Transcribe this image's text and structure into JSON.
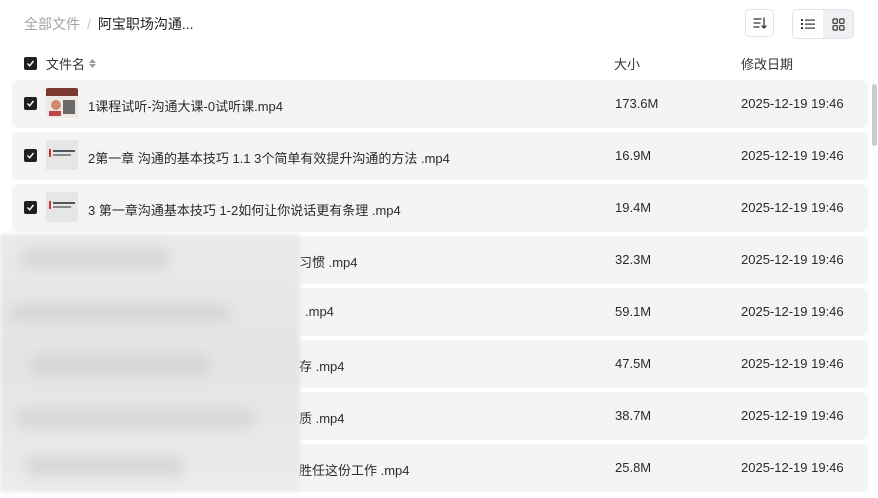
{
  "breadcrumb": {
    "root": "全部文件",
    "separator": "/",
    "current": "阿宝职场沟通..."
  },
  "toolbar": {
    "sort_icon": "sort-icon",
    "list_icon": "list-view-icon",
    "grid_icon": "grid-view-icon"
  },
  "header": {
    "name": "文件名",
    "size": "大小",
    "date": "修改日期"
  },
  "files": [
    {
      "name": "1课程试听-沟通大课-0试听课.mp4",
      "size": "173.6M",
      "date": "2025-12-19 19:46"
    },
    {
      "name": "2第一章 沟通的基本技巧 1.1 3个简单有效提升沟通的方法 .mp4",
      "size": "16.9M",
      "date": "2025-12-19 19:46"
    },
    {
      "name": "3 第一章沟通基本技巧 1-2如何让你说话更有条理 .mp4",
      "size": "19.4M",
      "date": "2025-12-19 19:46"
    },
    {
      "name": "习惯 .mp4",
      "size": "32.3M",
      "date": "2025-12-19 19:46"
    },
    {
      "name": ".mp4",
      "size": "59.1M",
      "date": "2025-12-19 19:46"
    },
    {
      "name": "存 .mp4",
      "size": "47.5M",
      "date": "2025-12-19 19:46"
    },
    {
      "name": "质 .mp4",
      "size": "38.7M",
      "date": "2025-12-19 19:46"
    },
    {
      "name": "胜任这份工作 .mp4",
      "size": "25.8M",
      "date": "2025-12-19 19:46"
    }
  ],
  "colors": {
    "row_bg": "#f4f4f5",
    "checkbox": "#1f1f1f",
    "muted": "#a0a3a8"
  }
}
